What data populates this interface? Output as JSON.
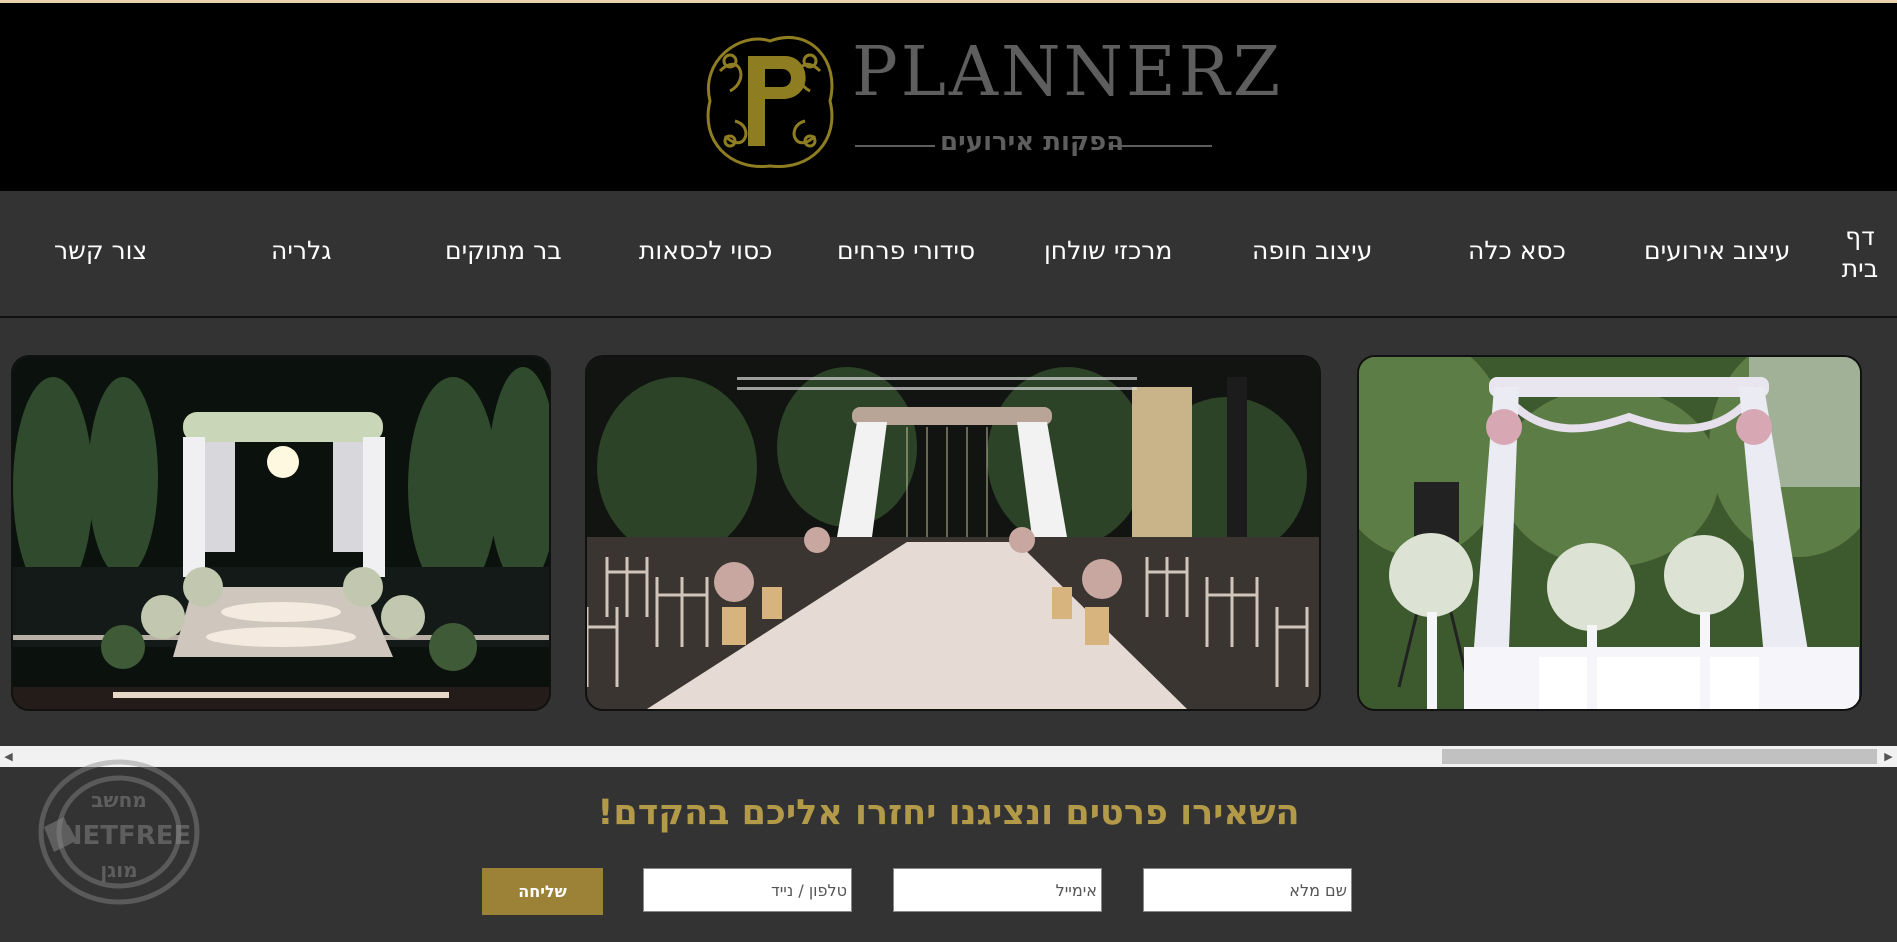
{
  "brand": {
    "name": "PLANNERZ",
    "tagline": "הפקות אירועים",
    "accent_color": "#b39a49"
  },
  "nav": {
    "items": [
      {
        "label": "דף בית"
      },
      {
        "label": "עיצוב אירועים"
      },
      {
        "label": "כסא כלה"
      },
      {
        "label": "עיצוב חופה"
      },
      {
        "label": "מרכזי שולחן"
      },
      {
        "label": "סידורי פרחים"
      },
      {
        "label": "כסוי לכסאות"
      },
      {
        "label": "בר מתוקים"
      },
      {
        "label": "גלריה"
      },
      {
        "label": "צור קשר"
      }
    ]
  },
  "gallery": {
    "photos": [
      {
        "name": "white-chuppah-garden-photo"
      },
      {
        "name": "chuppah-aisle-lanterns-photo"
      },
      {
        "name": "night-chuppah-pool-photo"
      }
    ]
  },
  "contact_form": {
    "heading": "השאירו פרטים ונציגנו יחזרו אליכם בהקדם!",
    "name_placeholder": "שם מלא",
    "email_placeholder": "אימייל",
    "phone_placeholder": "טלפון / נייד",
    "submit_label": "שליחה"
  },
  "netfree_badge": {
    "top": "מחשב",
    "middle": "NETFREE",
    "bottom": "מוגן"
  },
  "icons": {
    "scroll_left": "arrow-left-icon",
    "scroll_right": "arrow-right-icon"
  }
}
